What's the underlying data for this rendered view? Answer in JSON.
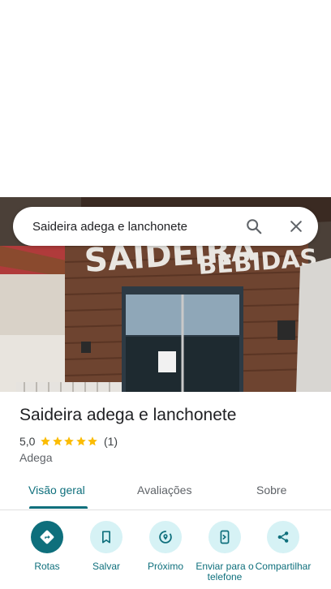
{
  "search": {
    "query": "Saideira adega e lanchonete"
  },
  "place": {
    "name": "Saideira adega e lanchonete",
    "rating": "5,0",
    "stars": 5,
    "review_count": "(1)",
    "category": "Adega"
  },
  "photo": {
    "sign_text_1": "SAIDEIRA",
    "sign_text_2": "BEBIDAS"
  },
  "tabs": [
    {
      "label": "Visão geral",
      "active": true
    },
    {
      "label": "Avaliações",
      "active": false
    },
    {
      "label": "Sobre",
      "active": false
    }
  ],
  "actions": [
    {
      "label": "Rotas",
      "icon": "directions-icon"
    },
    {
      "label": "Salvar",
      "icon": "bookmark-icon"
    },
    {
      "label": "Próximo",
      "icon": "nearby-icon"
    },
    {
      "label": "Enviar para o telefone",
      "icon": "send-to-phone-icon"
    },
    {
      "label": "Compartilhar",
      "icon": "share-icon"
    }
  ],
  "colors": {
    "accent": "#0e6f7c",
    "accent_light": "#d6f2f5",
    "star": "#fbbc04"
  }
}
